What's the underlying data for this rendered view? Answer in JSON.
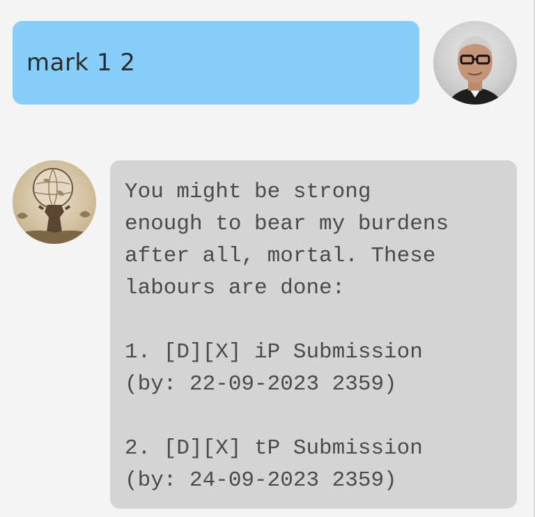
{
  "user_message": {
    "text": "mark 1 2",
    "avatar": "user-avatar"
  },
  "bot_message": {
    "avatar": "atlas-avatar",
    "lines": [
      "You might be strong",
      "enough to bear my burdens",
      "after all, mortal. These",
      "labours are done:",
      "",
      "1. [D][X] iP Submission",
      "(by: 22-09-2023 2359)",
      "",
      "2. [D][X] tP Submission",
      "(by: 24-09-2023 2359)"
    ]
  },
  "colors": {
    "background": "#f4f4f4",
    "user_bubble": "#87cefa",
    "bot_bubble": "#d4d4d4"
  }
}
